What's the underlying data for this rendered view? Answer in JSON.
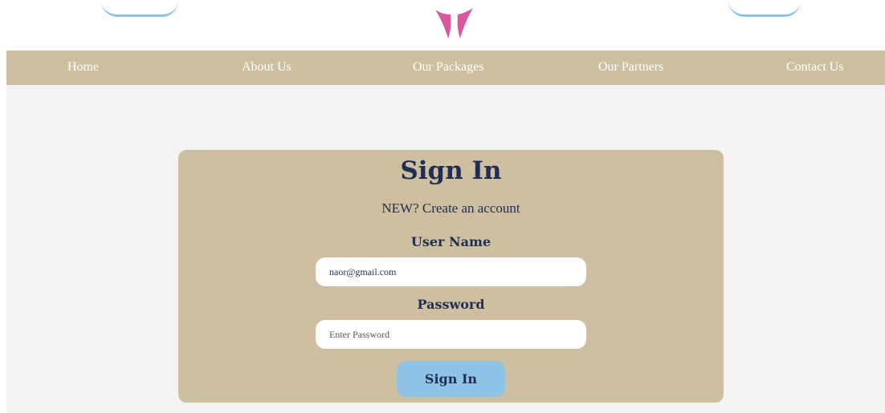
{
  "colors": {
    "nav_background": "#cdbf9f",
    "card_background": "#cdbf9f",
    "page_background": "#f4f4f4",
    "heading_text": "#1f2e52",
    "button_accent": "#8ec3e6",
    "logo_pink": "#d9579f"
  },
  "header": {
    "logo_icon": "butterfly-logo"
  },
  "nav": {
    "items": [
      {
        "label": "Home"
      },
      {
        "label": "About Us"
      },
      {
        "label": "Our Packages"
      },
      {
        "label": "Our Partners"
      },
      {
        "label": "Contact Us"
      }
    ]
  },
  "signin": {
    "title": "Sign In",
    "create_account": "NEW? Create an account",
    "username_label": "User Name",
    "username_value": "naor@gmail.com",
    "password_label": "Password",
    "password_placeholder": "Enter Password",
    "submit_label": "Sign In"
  }
}
